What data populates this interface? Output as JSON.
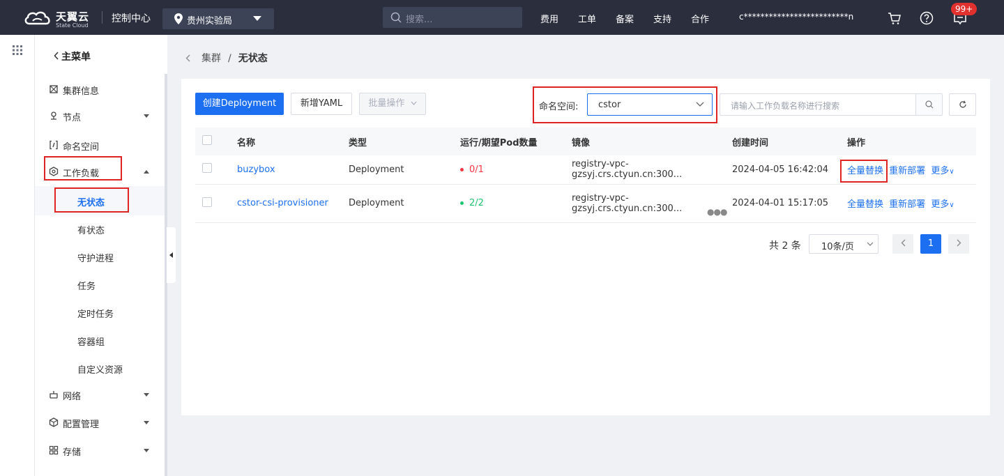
{
  "topbar": {
    "brand_cn": "天翼云",
    "brand_en": "State Cloud",
    "console": "控制中心",
    "region": "贵州实验局",
    "search_placeholder": "搜索...",
    "nav": [
      "费用",
      "工单",
      "备案",
      "支持",
      "合作"
    ],
    "account": "c*************************n",
    "badge": "99+"
  },
  "sidebar": {
    "head": "主菜单",
    "items": [
      {
        "label": "集群信息",
        "icon": "cluster-icon"
      },
      {
        "label": "节点",
        "icon": "node-icon"
      },
      {
        "label": "命名空间",
        "icon": "namespace-icon"
      },
      {
        "label": "工作负载",
        "icon": "workload-icon"
      }
    ],
    "workload_children": [
      "无状态",
      "有状态",
      "守护进程",
      "任务",
      "定时任务",
      "容器组",
      "自定义资源"
    ],
    "bottom_items": [
      {
        "label": "网络",
        "icon": "network-icon"
      },
      {
        "label": "配置管理",
        "icon": "config-icon"
      },
      {
        "label": "存储",
        "icon": "storage-icon"
      }
    ]
  },
  "breadcrumb": {
    "parent": "集群",
    "separator": "/",
    "current": "无状态"
  },
  "toolbar": {
    "create": "创建Deployment",
    "yaml": "新增YAML",
    "batch": "批量操作",
    "namespace_label": "命名空间:",
    "namespace_value": "cstor",
    "search_placeholder": "请输入工作负载名称进行搜索"
  },
  "table": {
    "headers": [
      "名称",
      "类型",
      "运行/期望Pod数量",
      "镜像",
      "创建时间",
      "操作"
    ],
    "rows": [
      {
        "name": "buzybox",
        "type": "Deployment",
        "pods": "0/1",
        "status_color": "#f5353f",
        "image": "registry-vpc-gzsyj.crs.ctyun.cn:300...",
        "created": "2024-04-05 16:42:04"
      },
      {
        "name": "cstor-csi-provisioner",
        "type": "Deployment",
        "pods": "2/2",
        "status_color": "#1fc46e",
        "image": "registry-vpc-gzsyj.crs.ctyun.cn:300...",
        "created": "2024-04-01 15:17:05"
      }
    ],
    "actions": {
      "replace": "全量替换",
      "redeploy": "重新部署",
      "more": "更多"
    }
  },
  "pager": {
    "total": "共 2 条",
    "size": "10条/页",
    "current": "1"
  },
  "colors": {
    "accent": "#1c6ff0",
    "highlight": "#e02424"
  }
}
